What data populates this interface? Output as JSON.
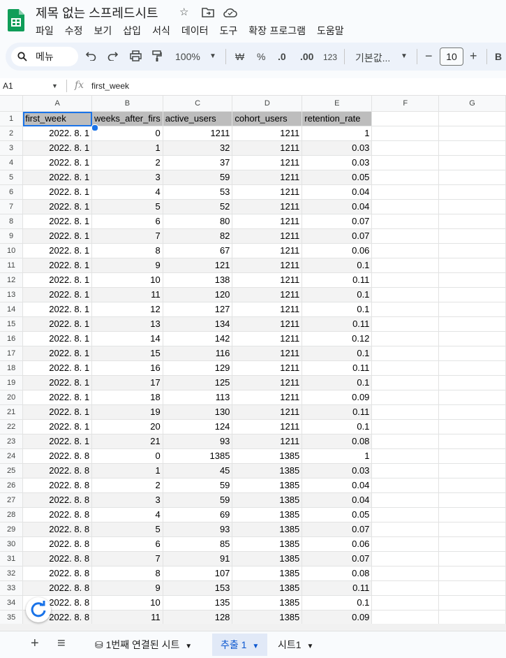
{
  "app": {
    "title": "제목 없는 스프레드시트",
    "menu": [
      "파일",
      "수정",
      "보기",
      "삽입",
      "서식",
      "데이터",
      "도구",
      "확장 프로그램",
      "도움말"
    ]
  },
  "toolbar": {
    "search_label": "메뉴",
    "zoom": "100%",
    "currency": "₩",
    "percent": "%",
    "decrease_decimal": ".0",
    "increase_decimal": ".00",
    "number_format": "123",
    "font": "기본값...",
    "font_size": "10",
    "minus": "−",
    "plus": "+",
    "bold": "B"
  },
  "formula": {
    "cell_ref": "A1",
    "fx": "fx",
    "content": "first_week"
  },
  "columns": [
    "A",
    "B",
    "C",
    "D",
    "E",
    "F",
    "G"
  ],
  "header_row": [
    "first_week",
    "weeks_after_firs",
    "active_users",
    "cohort_users",
    "retention_rate"
  ],
  "rows": [
    [
      "2022. 8. 1",
      "0",
      "1211",
      "1211",
      "1"
    ],
    [
      "2022. 8. 1",
      "1",
      "32",
      "1211",
      "0.03"
    ],
    [
      "2022. 8. 1",
      "2",
      "37",
      "1211",
      "0.03"
    ],
    [
      "2022. 8. 1",
      "3",
      "59",
      "1211",
      "0.05"
    ],
    [
      "2022. 8. 1",
      "4",
      "53",
      "1211",
      "0.04"
    ],
    [
      "2022. 8. 1",
      "5",
      "52",
      "1211",
      "0.04"
    ],
    [
      "2022. 8. 1",
      "6",
      "80",
      "1211",
      "0.07"
    ],
    [
      "2022. 8. 1",
      "7",
      "82",
      "1211",
      "0.07"
    ],
    [
      "2022. 8. 1",
      "8",
      "67",
      "1211",
      "0.06"
    ],
    [
      "2022. 8. 1",
      "9",
      "121",
      "1211",
      "0.1"
    ],
    [
      "2022. 8. 1",
      "10",
      "138",
      "1211",
      "0.11"
    ],
    [
      "2022. 8. 1",
      "11",
      "120",
      "1211",
      "0.1"
    ],
    [
      "2022. 8. 1",
      "12",
      "127",
      "1211",
      "0.1"
    ],
    [
      "2022. 8. 1",
      "13",
      "134",
      "1211",
      "0.11"
    ],
    [
      "2022. 8. 1",
      "14",
      "142",
      "1211",
      "0.12"
    ],
    [
      "2022. 8. 1",
      "15",
      "116",
      "1211",
      "0.1"
    ],
    [
      "2022. 8. 1",
      "16",
      "129",
      "1211",
      "0.11"
    ],
    [
      "2022. 8. 1",
      "17",
      "125",
      "1211",
      "0.1"
    ],
    [
      "2022. 8. 1",
      "18",
      "113",
      "1211",
      "0.09"
    ],
    [
      "2022. 8. 1",
      "19",
      "130",
      "1211",
      "0.11"
    ],
    [
      "2022. 8. 1",
      "20",
      "124",
      "1211",
      "0.1"
    ],
    [
      "2022. 8. 1",
      "21",
      "93",
      "1211",
      "0.08"
    ],
    [
      "2022. 8. 8",
      "0",
      "1385",
      "1385",
      "1"
    ],
    [
      "2022. 8. 8",
      "1",
      "45",
      "1385",
      "0.03"
    ],
    [
      "2022. 8. 8",
      "2",
      "59",
      "1385",
      "0.04"
    ],
    [
      "2022. 8. 8",
      "3",
      "59",
      "1385",
      "0.04"
    ],
    [
      "2022. 8. 8",
      "4",
      "69",
      "1385",
      "0.05"
    ],
    [
      "2022. 8. 8",
      "5",
      "93",
      "1385",
      "0.07"
    ],
    [
      "2022. 8. 8",
      "6",
      "85",
      "1385",
      "0.06"
    ],
    [
      "2022. 8. 8",
      "7",
      "91",
      "1385",
      "0.07"
    ],
    [
      "2022. 8. 8",
      "8",
      "107",
      "1385",
      "0.08"
    ],
    [
      "2022. 8. 8",
      "9",
      "153",
      "1385",
      "0.11"
    ],
    [
      "2022. 8. 8",
      "10",
      "135",
      "1385",
      "0.1"
    ],
    [
      "2022. 8. 8",
      "11",
      "128",
      "1385",
      "0.09"
    ]
  ],
  "sheets": {
    "add": "+",
    "list": "≡",
    "tabs": [
      {
        "label": "1번째 연결된 시트"
      },
      {
        "label": "추출 1"
      },
      {
        "label": "시트1"
      }
    ]
  },
  "colors": {
    "accent": "#1a73e8",
    "active_tab": "#0b57d0",
    "header_fill": "#bdbdbd",
    "band_fill": "#f3f3f3",
    "sheets_green": "#0f9d58"
  }
}
